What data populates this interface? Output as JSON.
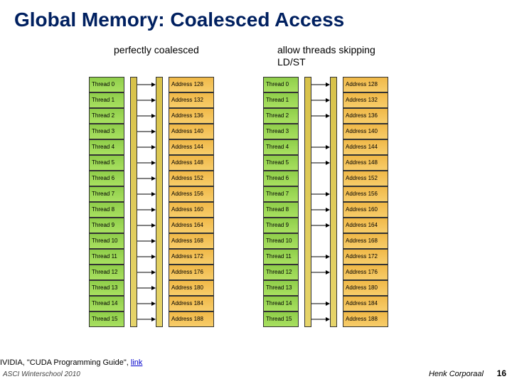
{
  "title": "Global Memory: Coalesced  Access",
  "caption_left": "perfectly coalesced",
  "caption_right": "allow threads skipping LD/ST",
  "threads": [
    "Thread 0",
    "Thread 1",
    "Thread 2",
    "Thread 3",
    "Thread 4",
    "Thread 5",
    "Thread 6",
    "Thread 7",
    "Thread 8",
    "Thread 9",
    "Thread 10",
    "Thread 11",
    "Thread 12",
    "Thread 13",
    "Thread 14",
    "Thread 15"
  ],
  "addresses": [
    "Address 128",
    "Address 132",
    "Address 136",
    "Address 140",
    "Address 144",
    "Address 148",
    "Address 152",
    "Address 156",
    "Address 160",
    "Address 164",
    "Address 168",
    "Address 172",
    "Address 176",
    "Address 180",
    "Address 184",
    "Address 188"
  ],
  "source_prefix": "IVIDIA, \"CUDA Programming Guide\", ",
  "source_link": "link",
  "event": "ASCI Winterschool 2010",
  "author": "Henk Corporaal",
  "page": "16",
  "chart_data": {
    "type": "diagram",
    "description": "Two mappings of GPU half-warp threads to global-memory addresses illustrating coalesced access",
    "left_mapping": {
      "label": "perfectly coalesced",
      "pairs": [
        [
          0,
          128
        ],
        [
          1,
          132
        ],
        [
          2,
          136
        ],
        [
          3,
          140
        ],
        [
          4,
          144
        ],
        [
          5,
          148
        ],
        [
          6,
          152
        ],
        [
          7,
          156
        ],
        [
          8,
          160
        ],
        [
          9,
          164
        ],
        [
          10,
          168
        ],
        [
          11,
          172
        ],
        [
          12,
          176
        ],
        [
          13,
          180
        ],
        [
          14,
          184
        ],
        [
          15,
          188
        ]
      ]
    },
    "right_mapping": {
      "label": "allow threads skipping LD/ST",
      "participating_threads": [
        0,
        1,
        2,
        4,
        5,
        7,
        8,
        9,
        11,
        12,
        14,
        15
      ],
      "pairs": [
        [
          0,
          128
        ],
        [
          1,
          132
        ],
        [
          2,
          136
        ],
        [
          4,
          144
        ],
        [
          5,
          148
        ],
        [
          7,
          156
        ],
        [
          8,
          160
        ],
        [
          9,
          164
        ],
        [
          11,
          172
        ],
        [
          12,
          176
        ],
        [
          14,
          184
        ],
        [
          15,
          188
        ]
      ]
    }
  }
}
